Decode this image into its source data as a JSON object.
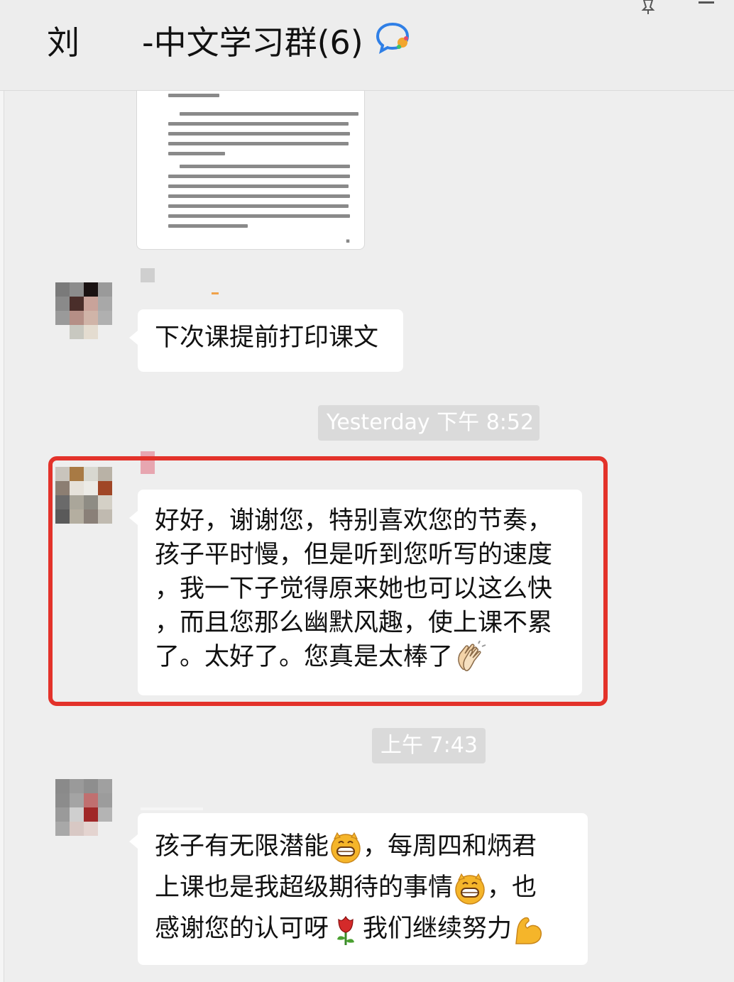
{
  "header": {
    "title_left": "刘",
    "title_right": "-中文学习群(6)",
    "group_icon": "chat-bubble-icon",
    "pin_icon": "pin-icon",
    "minimize_icon": "minimize-icon"
  },
  "messages": [
    {
      "type": "document-image",
      "icon": "document-preview"
    },
    {
      "type": "text",
      "text": "下次课提前打印课文"
    },
    {
      "type": "timestamp",
      "text": "Yesterday 下午 8:52"
    },
    {
      "type": "text",
      "lines": [
        "好好，谢谢您，特别喜欢您的节奏，",
        "孩子平时慢，但是听到您听写的速度",
        "，我一下子觉得原来她也可以这么快",
        "，而且您那么幽默风趣，使上课不累",
        "了。太好了。您真是太棒了"
      ],
      "emoji": "clapping-hands-icon",
      "highlighted": true
    },
    {
      "type": "timestamp",
      "text": "上午 7:43"
    },
    {
      "type": "text",
      "line1": {
        "a": "孩子有无限潜能",
        "b": "，每周四和炳君"
      },
      "line2": {
        "a": "上课也是我超级期待的事情",
        "b": "，也"
      },
      "line3": {
        "a": "感谢您的认可呀",
        "b": "我们继续努力"
      },
      "emojis": [
        "grinning-face-icon",
        "grinning-face-icon",
        "rose-icon",
        "flexed-biceps-icon"
      ]
    }
  ],
  "colors": {
    "highlight_border": "#e3322a",
    "chat_background": "#eeeeee",
    "bubble": "#ffffff",
    "timestamp_bg": "#dadada"
  }
}
